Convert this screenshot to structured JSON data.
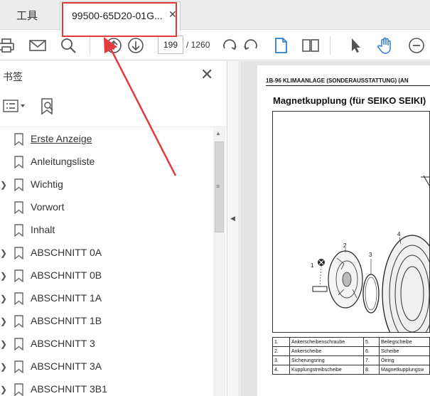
{
  "tabs": {
    "tools_label": "工具",
    "doc_label": "99500-65D20-01G...",
    "close_glyph": "✕"
  },
  "toolbar": {
    "icons": [
      "print-icon",
      "mail-icon",
      "search-icon",
      "page-up-icon",
      "page-down-icon",
      "rotate-cw-icon",
      "rotate-ccw-icon",
      "single-page-icon",
      "two-page-icon",
      "select-arrow-icon",
      "hand-tool-icon",
      "zoom-out-icon"
    ],
    "current_page": "199",
    "total_pages": "/ 1260",
    "accent_color": "#2b7bd8"
  },
  "bookmarks_panel": {
    "title": "书签",
    "items": [
      {
        "label": "Erste Anzeige",
        "expandable": false,
        "selected": true
      },
      {
        "label": "Anleitungsliste",
        "expandable": false,
        "selected": false
      },
      {
        "label": "Wichtig",
        "expandable": true,
        "selected": false
      },
      {
        "label": "Vorwort",
        "expandable": false,
        "selected": false
      },
      {
        "label": "Inhalt",
        "expandable": false,
        "selected": false
      },
      {
        "label": "ABSCHNITT 0A",
        "expandable": true,
        "selected": false
      },
      {
        "label": "ABSCHNITT 0B",
        "expandable": true,
        "selected": false
      },
      {
        "label": "ABSCHNITT 1A",
        "expandable": true,
        "selected": false
      },
      {
        "label": "ABSCHNITT 1B",
        "expandable": true,
        "selected": false
      },
      {
        "label": "ABSCHNITT 3",
        "expandable": true,
        "selected": false
      },
      {
        "label": "ABSCHNITT 3A",
        "expandable": true,
        "selected": false
      },
      {
        "label": "ABSCHNITT 3B1",
        "expandable": true,
        "selected": false
      }
    ]
  },
  "document": {
    "header": "1B-96 KLIMAANLAGE (SONDERAUSSTATTUNG) (AN",
    "heading": "Magnetkupplung (für SEIKO SEIKI)",
    "callouts": [
      "1",
      "2",
      "3",
      "4"
    ],
    "parts": [
      [
        "1.",
        "Ankerscheibenschraube",
        "5.",
        "Beilegscheibe"
      ],
      [
        "2.",
        "Ankerscheibe",
        "6.",
        "Scheibe"
      ],
      [
        "3.",
        "Sicherungsring",
        "7.",
        "Öiring"
      ],
      [
        "4.",
        "Kupplungstreibscheibe",
        "8.",
        "Magnetkupplungsw"
      ]
    ]
  },
  "annotation": {
    "highlight_color": "#e33b3b"
  }
}
